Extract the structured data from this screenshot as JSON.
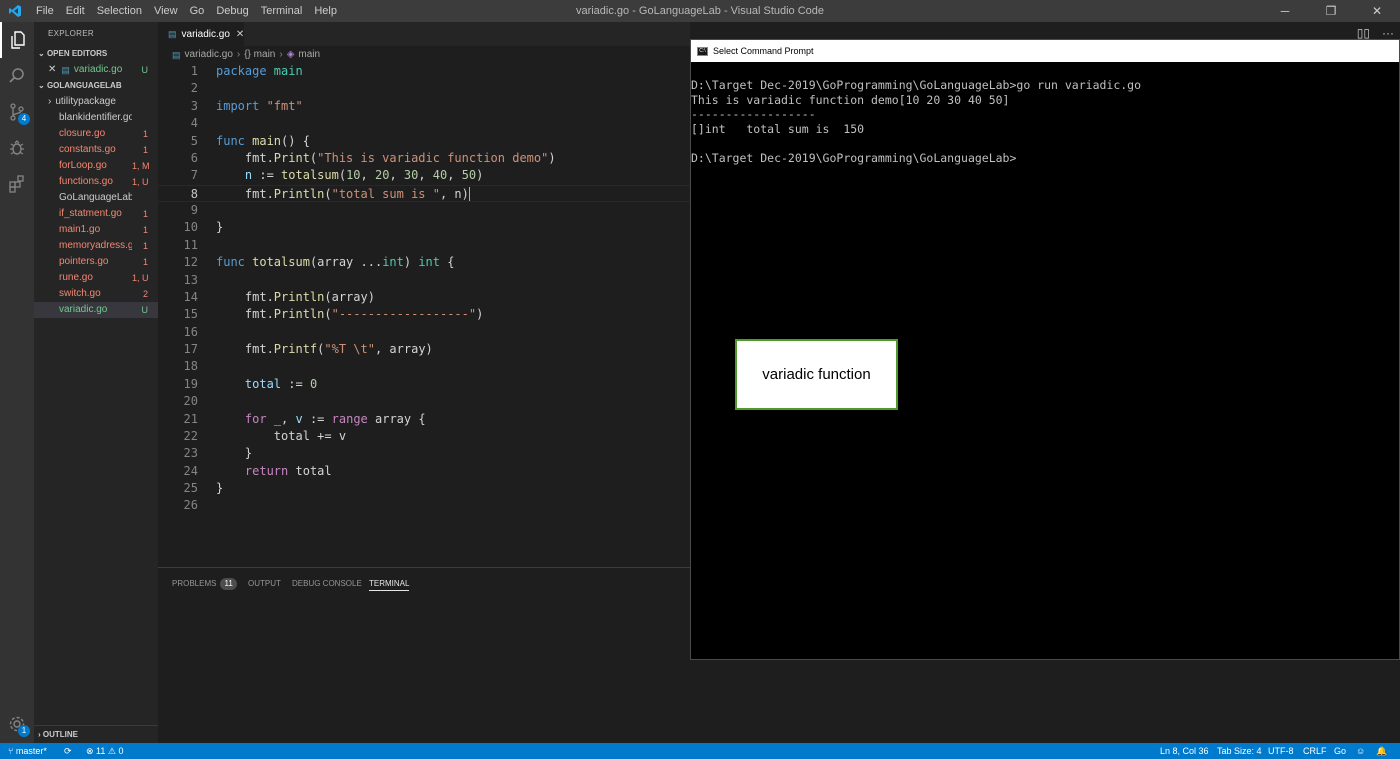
{
  "titlebar": {
    "menu": [
      "File",
      "Edit",
      "Selection",
      "View",
      "Go",
      "Debug",
      "Terminal",
      "Help"
    ],
    "window_title": "variadic.go - GoLanguageLab - Visual Studio Code",
    "controls": [
      "─",
      "❐",
      "✕"
    ]
  },
  "activity": {
    "scm_badge": "4",
    "settings_badge": "1"
  },
  "sidebar": {
    "title": "EXPLORER",
    "open_editors_label": "OPEN EDITORS",
    "open_editor": {
      "close": "✕",
      "name": "variadic.go",
      "status": "U"
    },
    "project_label": "GOLANGUAGELAB",
    "files": [
      {
        "name": "utilitypackage",
        "status": "",
        "color": "#cccccc",
        "folder": true
      },
      {
        "name": "blankidentifier.go",
        "status": "",
        "color": "#cccccc"
      },
      {
        "name": "closure.go",
        "status": "1",
        "color": "#f48771"
      },
      {
        "name": "constants.go",
        "status": "1",
        "color": "#f48771"
      },
      {
        "name": "forLoop.go",
        "status": "1, M",
        "color": "#f48771"
      },
      {
        "name": "functions.go",
        "status": "1, U",
        "color": "#f48771"
      },
      {
        "name": "GoLanguageLab.exe",
        "status": "",
        "color": "#cccccc"
      },
      {
        "name": "if_statment.go",
        "status": "1",
        "color": "#f48771"
      },
      {
        "name": "main1.go",
        "status": "1",
        "color": "#f48771"
      },
      {
        "name": "memoryadress.go",
        "status": "1",
        "color": "#f48771"
      },
      {
        "name": "pointers.go",
        "status": "1",
        "color": "#f48771"
      },
      {
        "name": "rune.go",
        "status": "1, U",
        "color": "#f48771"
      },
      {
        "name": "switch.go",
        "status": "2",
        "color": "#f48771"
      },
      {
        "name": "variadic.go",
        "status": "U",
        "color": "#73c991",
        "selected": true
      }
    ],
    "outline_label": "OUTLINE"
  },
  "editor": {
    "tab": {
      "name": "variadic.go",
      "close": "✕"
    },
    "breadcrumb": [
      "variadic.go",
      "{} main",
      "main"
    ],
    "line_numbers": [
      "1",
      "2",
      "3",
      "4",
      "5",
      "6",
      "7",
      "8",
      "9",
      "10",
      "11",
      "12",
      "13",
      "14",
      "15",
      "16",
      "17",
      "18",
      "19",
      "20",
      "21",
      "22",
      "23",
      "24",
      "25",
      "26"
    ],
    "code": {
      "l1a": "package",
      "l1b": " main",
      "l3a": "import",
      "l3b": " \"fmt\"",
      "l5a": "func",
      "l5b": " main",
      "l5c": "() {",
      "l6a": "    fmt.",
      "l6b": "Print",
      "l6c": "(",
      "l6d": "\"This is variadic function demo\"",
      "l6e": ")",
      "l7a": "    ",
      "l7b": "n",
      "l7c": " := ",
      "l7d": "totalsum",
      "l7e": "(",
      "l7f": "10",
      "l7g": ", ",
      "l7h": "20",
      "l7i": ", ",
      "l7j": "30",
      "l7k": ", ",
      "l7l": "40",
      "l7m": ", ",
      "l7n": "50",
      "l7o": ")",
      "l8a": "    fmt.",
      "l8b": "Println",
      "l8c": "(",
      "l8d": "\"total sum is \"",
      "l8e": ", n)",
      "l10a": "}",
      "l12a": "func",
      "l12b": " totalsum",
      "l12c": "(array ...",
      "l12d": "int",
      "l12e": ") ",
      "l12f": "int",
      "l12g": " {",
      "l14a": "    fmt.",
      "l14b": "Println",
      "l14c": "(array)",
      "l15a": "    fmt.",
      "l15b": "Println",
      "l15c": "(",
      "l15d": "\"------------------\"",
      "l15e": ")",
      "l17a": "    fmt.",
      "l17b": "Printf",
      "l17c": "(",
      "l17d": "\"%T \\t\"",
      "l17e": ", array)",
      "l19a": "    ",
      "l19b": "total",
      "l19c": " := ",
      "l19d": "0",
      "l21a": "    ",
      "l21b": "for",
      "l21c": " _, ",
      "l21d": "v",
      "l21e": " := ",
      "l21f": "range",
      "l21g": " array {",
      "l22a": "        total += v",
      "l23a": "    }",
      "l24a": "    ",
      "l24b": "return",
      "l24c": " total",
      "l25a": "}"
    }
  },
  "panel": {
    "tabs": [
      "PROBLEMS",
      "OUTPUT",
      "DEBUG CONSOLE",
      "TERMINAL"
    ],
    "problems_count": "11"
  },
  "status": {
    "branch": "master*",
    "sync": "⟳",
    "errors": "11",
    "warnings": "0",
    "position": "Ln 8, Col 36",
    "tab_size": "Tab Size: 4",
    "encoding": "UTF-8",
    "eol": "CRLF",
    "language": "Go",
    "feedback": "☺",
    "bell": "🔔"
  },
  "cmd": {
    "title": "Select Command Prompt",
    "lines": [
      "D:\\Target Dec-2019\\GoProgramming\\GoLanguageLab>go run variadic.go",
      "This is variadic function demo[10 20 30 40 50]",
      "------------------",
      "[]int   total sum is  150",
      "",
      "D:\\Target Dec-2019\\GoProgramming\\GoLanguageLab>"
    ]
  },
  "annotation": {
    "text": "variadic function"
  }
}
